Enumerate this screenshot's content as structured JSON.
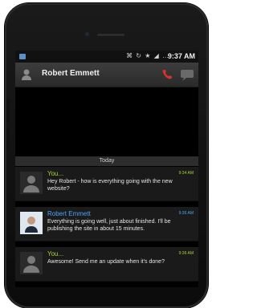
{
  "status_bar": {
    "icons": "⌘ ↻ ★ ◢ …",
    "time": "9:37 AM"
  },
  "app_bar": {
    "title": "Robert Emmett",
    "icons": {
      "contact": "contact-icon",
      "call": "call-icon",
      "chat": "chat-icon"
    }
  },
  "conversation": {
    "date_label": "Today",
    "messages": [
      {
        "sender": "You...",
        "time": "9:34 AM",
        "text": "Hey Robert - how is everything going with the new website?",
        "avatar": "default-avatar",
        "sender_type": "you"
      },
      {
        "sender": "Robert Emmett",
        "time": "9:36 AM",
        "text": "Everything is going well, just about finished. I'll be publishing the site in about 15 minutes.",
        "avatar": "photo-avatar",
        "sender_type": "other"
      },
      {
        "sender": "You...",
        "time": "9:36 AM",
        "text": "Awesome! Send me an update when it's done?",
        "avatar": "default-avatar",
        "sender_type": "you"
      }
    ]
  },
  "colors": {
    "you_accent": "#a6d13a",
    "other_accent": "#4ba3ff",
    "call_icon": "#d6332f"
  }
}
